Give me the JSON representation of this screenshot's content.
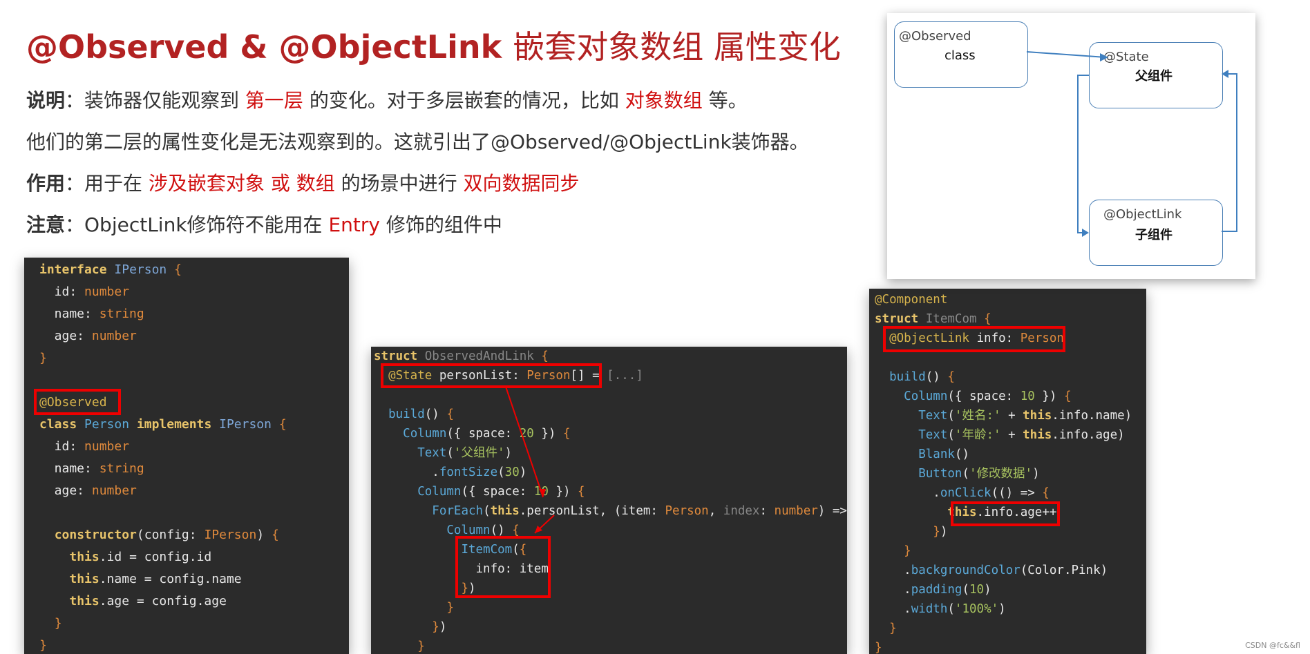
{
  "title": {
    "bold": "@Observed & @ObjectLink",
    "rest": "嵌套对象数组 属性变化"
  },
  "desc": {
    "l1_label": "说明",
    "l1_a": "：装饰器仅能观察到 ",
    "l1_red1": "第一层",
    "l1_b": " 的变化。对于多层嵌套的情况，比如 ",
    "l1_red2": "对象数组",
    "l1_c": " 等。",
    "l2": "他们的第二层的属性变化是无法观察到的。这就引出了@Observed/@ObjectLink装饰器。",
    "l3_label": "作用",
    "l3_a": "：用于在 ",
    "l3_red1": "涉及嵌套对象 或 数组",
    "l3_b": " 的场景中进行 ",
    "l3_red2": "双向数据同步",
    "l4_label": "注意",
    "l4_a": "：ObjectLink修饰符不能用在 ",
    "l4_red": "Entry",
    "l4_b": " 修饰的组件中"
  },
  "diagram": {
    "observed_label": "@Observed",
    "observed_sub": "class",
    "state_label": "@State",
    "state_sub": "父组件",
    "link_label": "@ObjectLink",
    "link_sub": "子组件"
  },
  "watermark": "CSDN @fc&&fl"
}
